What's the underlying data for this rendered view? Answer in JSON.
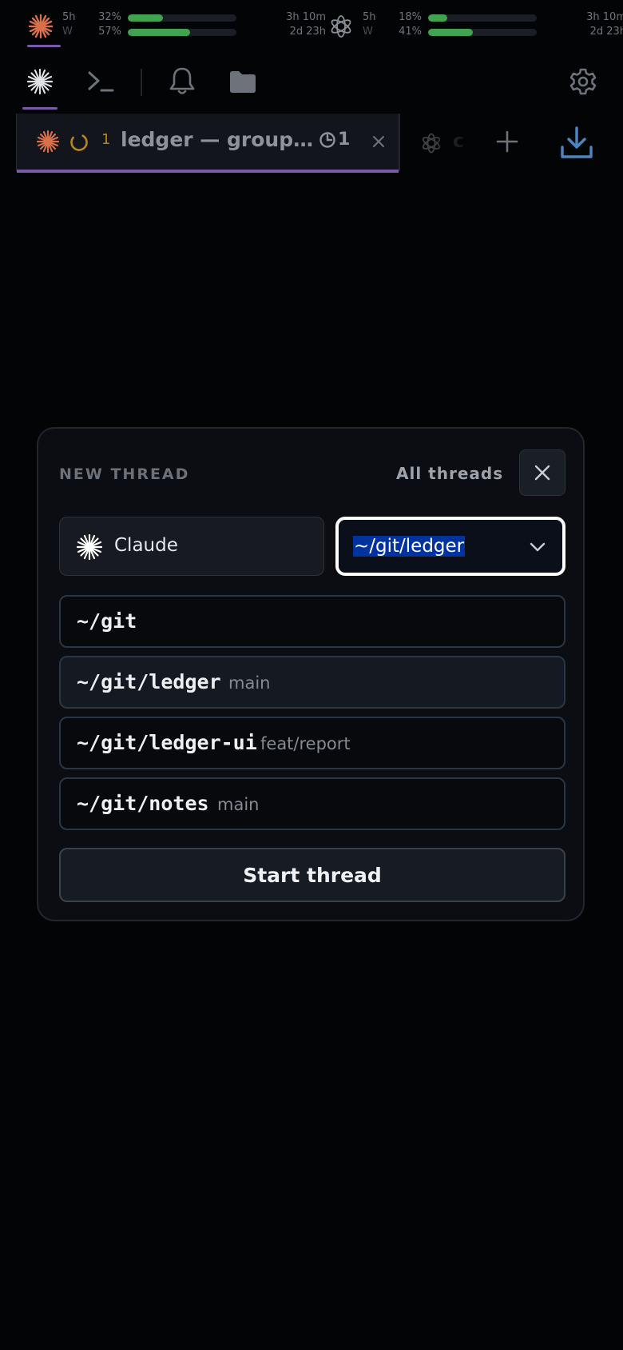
{
  "usage": {
    "claude": {
      "icon": "claude-sunburst-icon",
      "rows": [
        {
          "window": "5h",
          "percent": "32%",
          "fill": 0.32,
          "reset": "3h 10m"
        },
        {
          "window": "W",
          "percent": "57%",
          "fill": 0.57,
          "reset": "2d 23h"
        }
      ]
    },
    "openai": {
      "icon": "openai-logo-icon",
      "rows": [
        {
          "window": "5h",
          "percent": "18%",
          "fill": 0.18,
          "reset": "3h 10m"
        },
        {
          "window": "W",
          "percent": "41%",
          "fill": 0.41,
          "reset": "2d 23h"
        }
      ]
    }
  },
  "toolbar": {
    "items": [
      "claude-icon",
      "terminal-icon",
      "bell-icon",
      "folder-icon"
    ],
    "settings": "gear-icon"
  },
  "tabs": {
    "active": {
      "count": "1",
      "title": "ledger — grouping by month",
      "badge": "1",
      "icons": [
        "claude-sunburst-icon",
        "spinner-icon",
        "clock-icon",
        "close-icon"
      ]
    },
    "inactive": {
      "peek": "c",
      "icon": "openai-logo-icon"
    },
    "add": "plus-icon",
    "download": "download-icon"
  },
  "dialog": {
    "heading": "NEW THREAD",
    "all_threads": "All threads",
    "agent": "Claude",
    "selected_path": "~/git/ledger",
    "paths": [
      {
        "path": "~/git",
        "branch": ""
      },
      {
        "path": "~/git/ledger",
        "branch": "main"
      },
      {
        "path": "~/git/ledger-ui",
        "branch": "feat/report"
      },
      {
        "path": "~/git/notes",
        "branch": "main"
      }
    ],
    "start_label": "Start thread"
  },
  "colors": {
    "accent": "#7a5aa8",
    "claude": "#d9704a",
    "usage_fill": "#3fa350",
    "selection": "#0033a0"
  }
}
